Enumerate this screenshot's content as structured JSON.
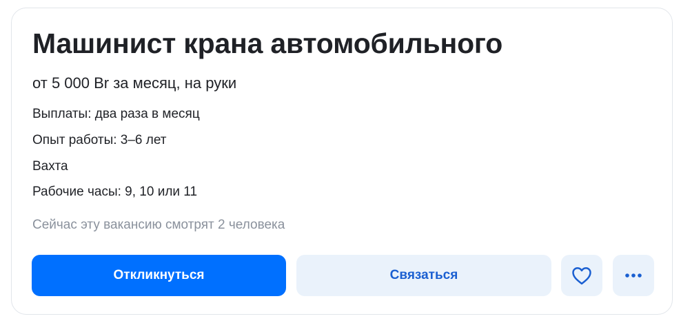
{
  "vacancy": {
    "title": "Машинист крана автомобильного",
    "salary": "от 5 000 Br за месяц, на руки",
    "details": [
      "Выплаты: два раза в месяц",
      "Опыт работы: 3–6 лет",
      "Вахта",
      "Рабочие часы: 9, 10 или 11"
    ],
    "viewers": "Сейчас эту вакансию смотрят 2 человека"
  },
  "actions": {
    "respond_label": "Откликнуться",
    "contact_label": "Связаться",
    "favorite_icon": "heart-icon",
    "more_icon": "more-dots-icon"
  },
  "colors": {
    "primary": "#0070ff",
    "secondary_bg": "#eaf2fb",
    "secondary_text": "#1a5fd1",
    "muted_text": "#8a919c"
  }
}
